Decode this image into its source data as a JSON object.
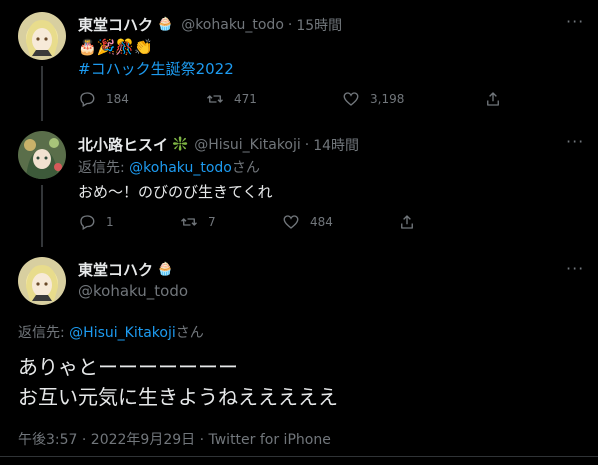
{
  "tweet1": {
    "name": "東堂コハク",
    "name_badge": "🧁",
    "handle": "@kohaku_todo",
    "separator": "·",
    "time": "15時間",
    "emojis": "🎂🎉🎊👏",
    "hashtag": "#コハック生誕祭2022",
    "actions": {
      "reply": "184",
      "retweet": "471",
      "like": "3,198"
    }
  },
  "tweet2": {
    "name": "北小路ヒスイ",
    "name_badge": "❇️",
    "handle": "@Hisui_Kitakoji",
    "separator": "·",
    "time": "14時間",
    "reply_to_prefix": "返信先: ",
    "reply_to_handle": "@kohaku_todo",
    "reply_to_suffix": "さん",
    "text": "おめ～！のびのび生きてくれ",
    "actions": {
      "reply": "1",
      "retweet": "7",
      "like": "484"
    }
  },
  "tweet3": {
    "name": "東堂コハク",
    "name_badge": "🧁",
    "handle": "@kohaku_todo",
    "reply_to_prefix": "返信先: ",
    "reply_to_handle": "@Hisui_Kitakoji",
    "reply_to_suffix": "さん",
    "text_line1": "ありゃとーーーーーーー",
    "text_line2": "お互い元気に生きようねえええええ",
    "timestamp": "午後3:57 · 2022年9月29日 · Twitter for iPhone"
  },
  "colors": {
    "background": "#000000",
    "text": "#e7e9ea",
    "muted": "#71767b",
    "link": "#1d9bf0",
    "thread_line": "#333639"
  }
}
